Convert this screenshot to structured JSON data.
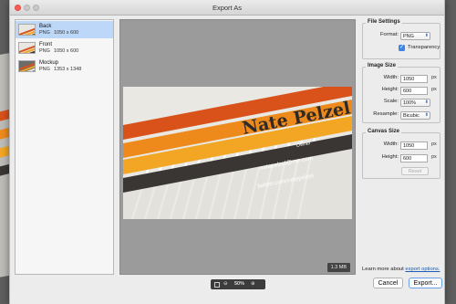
{
  "window": {
    "title": "Export As"
  },
  "assets": [
    {
      "name": "Back",
      "format": "PNG",
      "dimensions": "1050 x 600",
      "selected": true
    },
    {
      "name": "Front",
      "format": "PNG",
      "dimensions": "1050 x 600",
      "selected": false
    },
    {
      "name": "Mockup",
      "format": "PNG",
      "dimensions": "1353 x 1348",
      "selected": false
    }
  ],
  "preview": {
    "card": {
      "name": "Nate Pelzel",
      "role": "Owner",
      "email": "natepelzel@me.com",
      "twitter": "twitter.com/natepelzel",
      "colors": {
        "orange_red": "#d8521a",
        "orange": "#ee8a1c",
        "gold": "#f2a623",
        "charcoal": "#3a3634",
        "background": "#e9e8e3"
      }
    },
    "file_size": "1.3 MB",
    "zoom": "50%"
  },
  "file_settings": {
    "title": "File Settings",
    "format_label": "Format:",
    "format_value": "PNG",
    "transparency_label": "Transparency",
    "transparency_checked": true
  },
  "image_size": {
    "title": "Image Size",
    "width_label": "Width:",
    "width_value": "1050",
    "width_unit": "px",
    "height_label": "Height:",
    "height_value": "600",
    "height_unit": "px",
    "scale_label": "Scale:",
    "scale_value": "100%",
    "resample_label": "Resample:",
    "resample_value": "Bicubic"
  },
  "canvas_size": {
    "title": "Canvas Size",
    "width_label": "Width:",
    "width_value": "1050",
    "width_unit": "px",
    "height_label": "Height:",
    "height_value": "600",
    "height_unit": "px",
    "reset_label": "Reset"
  },
  "footer": {
    "learn_text": "Learn more about",
    "learn_link": "export options.",
    "cancel_label": "Cancel",
    "export_label": "Export..."
  },
  "accent_color": "#3d86e6"
}
